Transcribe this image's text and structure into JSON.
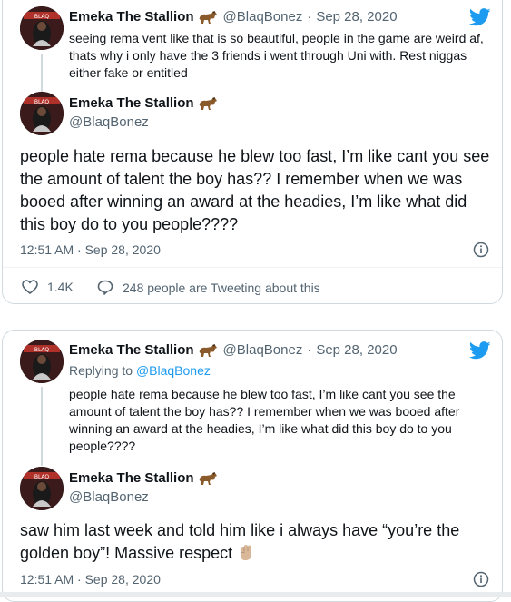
{
  "author": {
    "name": "Emeka The Stallion",
    "handle": "@BlaqBonez",
    "emoji_name": "horse-emoji"
  },
  "card1": {
    "tweet1": {
      "date": "Sep 28, 2020",
      "text": "seeing rema vent like that is so beautiful, people in the game are weird af, thats why i only have the 3 friends i went through Uni with. Rest niggas either fake or entitled"
    },
    "main": {
      "text": "people hate rema because he blew too fast, I’m like cant you see the amount of talent the boy has?? I remember when we was booed after winning an award at the headies, I’m like what did this boy do to you people????",
      "timestamp": "12:51 AM · Sep 28, 2020",
      "likes": "1.4K",
      "tweeting": "248 people are Tweeting about this"
    }
  },
  "card2": {
    "tweet1": {
      "date": "Sep 28, 2020",
      "replying_prefix": "Replying to",
      "replying_handle": "@BlaqBonez",
      "text": "people hate rema because he blew too fast, I’m like cant you see the amount of talent the boy has?? I remember when we was booed after winning an award at the headies, I’m like what did this boy do to you people????"
    },
    "main": {
      "text": "saw him last week and told him like i always have “you’re the golden boy”! Massive respect",
      "emoji_name": "raised-fist-emoji",
      "timestamp": "12:51 AM · Sep 28, 2020"
    }
  },
  "colors": {
    "twitter_blue": "#1d9bf0",
    "secondary_text": "#536471",
    "border": "#cfd9de"
  }
}
